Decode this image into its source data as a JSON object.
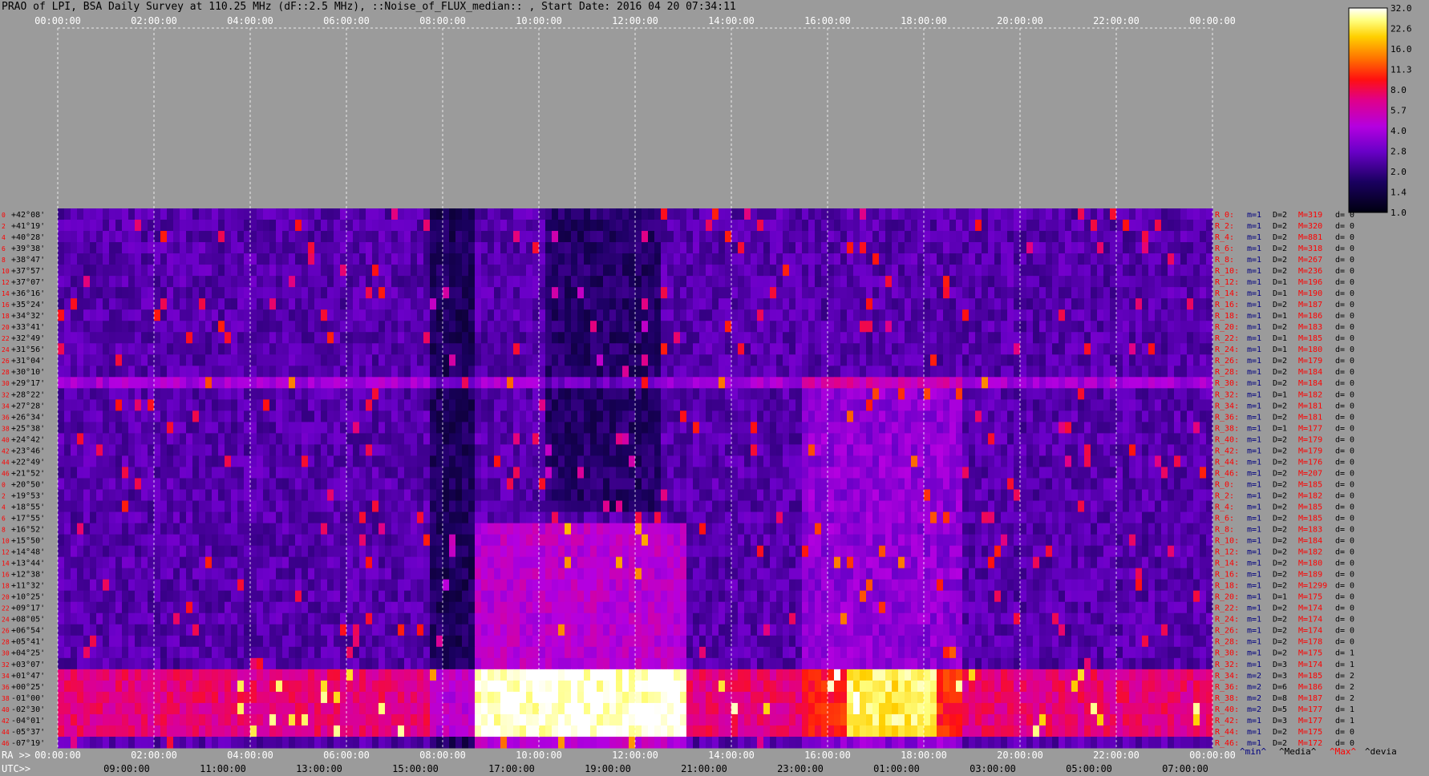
{
  "title": "PRAO of LPI, BSA Daily Survey at 110.25 MHz (dF::2.5 MHz), ::Noise_of_FLUX_median:: , Start Date: 2016 04 20 07:34:11",
  "chart_data": {
    "type": "heatmap",
    "title": "PRAO of LPI, BSA Daily Survey at 110.25 MHz (dF::2.5 MHz), ::Noise_of_FLUX_median:: , Start Date: 2016 04 20 07:34:11",
    "x_top_ticks": [
      "00:00:00",
      "02:00:00",
      "04:00:00",
      "06:00:00",
      "08:00:00",
      "10:00:00",
      "12:00:00",
      "14:00:00",
      "16:00:00",
      "18:00:00",
      "20:00:00",
      "22:00:00",
      "00:00:00"
    ],
    "ra_label": "RA >>",
    "ra_ticks": [
      "00:00:00",
      "02:00:00",
      "04:00:00",
      "06:00:00",
      "08:00:00",
      "10:00:00",
      "12:00:00",
      "14:00:00",
      "16:00:00",
      "18:00:00",
      "20:00:00",
      "22:00:00",
      "00:00:00"
    ],
    "utc_label": "UTC>>",
    "utc_ticks": [
      "09:00:00",
      "11:00:00",
      "13:00:00",
      "15:00:00",
      "17:00:00",
      "19:00:00",
      "21:00:00",
      "23:00:00",
      "01:00:00",
      "03:00:00",
      "05:00:00",
      "07:00:00"
    ],
    "declinations": [
      "+42°08'",
      "+41°19'",
      "+40°28'",
      "+39°38'",
      "+38°47'",
      "+37°57'",
      "+37°07'",
      "+36°16'",
      "+35°24'",
      "+34°32'",
      "+33°41'",
      "+32°49'",
      "+31°56'",
      "+31°04'",
      "+30°10'",
      "+29°17'",
      "+28°22'",
      "+27°28'",
      "+26°34'",
      "+25°38'",
      "+24°42'",
      "+23°46'",
      "+22°49'",
      "+21°52'",
      "+20°50'",
      "+19°53'",
      "+18°55'",
      "+17°55'",
      "+16°52'",
      "+15°50'",
      "+14°48'",
      "+13°44'",
      "+12°38'",
      "+11°32'",
      "+10°25'",
      "+09°17'",
      "+08°05'",
      "+06°54'",
      "+05°41'",
      "+04°25'",
      "+03°07'",
      "+01°47'",
      "+00°25'",
      "-01°00'",
      "-02°30'",
      "-04°01'",
      "-05°37'",
      "-07°19'"
    ],
    "row_index_labels": [
      "0",
      "2",
      "4",
      "6",
      "8",
      "10",
      "12",
      "14",
      "16",
      "18",
      "20",
      "22",
      "24",
      "26",
      "28",
      "30",
      "32",
      "34",
      "36",
      "38",
      "40",
      "42",
      "44",
      "46",
      "0",
      "2",
      "4",
      "6",
      "8",
      "10",
      "12",
      "14",
      "16",
      "18",
      "20",
      "22",
      "24",
      "26",
      "28",
      "30",
      "32",
      "34",
      "36",
      "38",
      "40",
      "42",
      "44",
      "46"
    ],
    "rows": [
      {
        "r": "R_0:",
        "min": "m=1",
        "dev": "D=2",
        "max": "M=319",
        "d": "d= 0"
      },
      {
        "r": "R_2:",
        "min": "m=1",
        "dev": "D=2",
        "max": "M=320",
        "d": "d= 0"
      },
      {
        "r": "R_4:",
        "min": "m=1",
        "dev": "D=2",
        "max": "M=881",
        "d": "d= 0"
      },
      {
        "r": "R_6:",
        "min": "m=1",
        "dev": "D=2",
        "max": "M=318",
        "d": "d= 0"
      },
      {
        "r": "R_8:",
        "min": "m=1",
        "dev": "D=2",
        "max": "M=267",
        "d": "d= 0"
      },
      {
        "r": "R_10:",
        "min": "m=1",
        "dev": "D=2",
        "max": "M=236",
        "d": "d= 0"
      },
      {
        "r": "R_12:",
        "min": "m=1",
        "dev": "D=1",
        "max": "M=196",
        "d": "d= 0"
      },
      {
        "r": "R_14:",
        "min": "m=1",
        "dev": "D=1",
        "max": "M=190",
        "d": "d= 0"
      },
      {
        "r": "R_16:",
        "min": "m=1",
        "dev": "D=2",
        "max": "M=187",
        "d": "d= 0"
      },
      {
        "r": "R_18:",
        "min": "m=1",
        "dev": "D=1",
        "max": "M=186",
        "d": "d= 0"
      },
      {
        "r": "R_20:",
        "min": "m=1",
        "dev": "D=2",
        "max": "M=183",
        "d": "d= 0"
      },
      {
        "r": "R_22:",
        "min": "m=1",
        "dev": "D=1",
        "max": "M=185",
        "d": "d= 0"
      },
      {
        "r": "R_24:",
        "min": "m=1",
        "dev": "D=1",
        "max": "M=180",
        "d": "d= 0"
      },
      {
        "r": "R_26:",
        "min": "m=1",
        "dev": "D=2",
        "max": "M=179",
        "d": "d= 0"
      },
      {
        "r": "R_28:",
        "min": "m=1",
        "dev": "D=2",
        "max": "M=184",
        "d": "d= 0"
      },
      {
        "r": "R_30:",
        "min": "m=1",
        "dev": "D=2",
        "max": "M=184",
        "d": "d= 0"
      },
      {
        "r": "R_32:",
        "min": "m=1",
        "dev": "D=1",
        "max": "M=182",
        "d": "d= 0"
      },
      {
        "r": "R_34:",
        "min": "m=1",
        "dev": "D=2",
        "max": "M=181",
        "d": "d= 0"
      },
      {
        "r": "R_36:",
        "min": "m=1",
        "dev": "D=2",
        "max": "M=181",
        "d": "d= 0"
      },
      {
        "r": "R_38:",
        "min": "m=1",
        "dev": "D=1",
        "max": "M=177",
        "d": "d= 0"
      },
      {
        "r": "R_40:",
        "min": "m=1",
        "dev": "D=2",
        "max": "M=179",
        "d": "d= 0"
      },
      {
        "r": "R_42:",
        "min": "m=1",
        "dev": "D=2",
        "max": "M=179",
        "d": "d= 0"
      },
      {
        "r": "R_44:",
        "min": "m=1",
        "dev": "D=2",
        "max": "M=176",
        "d": "d= 0"
      },
      {
        "r": "R_46:",
        "min": "m=1",
        "dev": "D=2",
        "max": "M=207",
        "d": "d= 0"
      },
      {
        "r": "R_0:",
        "min": "m=1",
        "dev": "D=2",
        "max": "M=185",
        "d": "d= 0"
      },
      {
        "r": "R_2:",
        "min": "m=1",
        "dev": "D=2",
        "max": "M=182",
        "d": "d= 0"
      },
      {
        "r": "R_4:",
        "min": "m=1",
        "dev": "D=2",
        "max": "M=185",
        "d": "d= 0"
      },
      {
        "r": "R_6:",
        "min": "m=1",
        "dev": "D=2",
        "max": "M=185",
        "d": "d= 0"
      },
      {
        "r": "R_8:",
        "min": "m=1",
        "dev": "D=2",
        "max": "M=183",
        "d": "d= 0"
      },
      {
        "r": "R_10:",
        "min": "m=1",
        "dev": "D=2",
        "max": "M=184",
        "d": "d= 0"
      },
      {
        "r": "R_12:",
        "min": "m=1",
        "dev": "D=2",
        "max": "M=182",
        "d": "d= 0"
      },
      {
        "r": "R_14:",
        "min": "m=1",
        "dev": "D=2",
        "max": "M=180",
        "d": "d= 0"
      },
      {
        "r": "R_16:",
        "min": "m=1",
        "dev": "D=2",
        "max": "M=189",
        "d": "d= 0"
      },
      {
        "r": "R_18:",
        "min": "m=1",
        "dev": "D=2",
        "max": "M=1299",
        "d": "d= 0"
      },
      {
        "r": "R_20:",
        "min": "m=1",
        "dev": "D=1",
        "max": "M=175",
        "d": "d= 0"
      },
      {
        "r": "R_22:",
        "min": "m=1",
        "dev": "D=2",
        "max": "M=174",
        "d": "d= 0"
      },
      {
        "r": "R_24:",
        "min": "m=1",
        "dev": "D=2",
        "max": "M=174",
        "d": "d= 0"
      },
      {
        "r": "R_26:",
        "min": "m=1",
        "dev": "D=2",
        "max": "M=174",
        "d": "d= 0"
      },
      {
        "r": "R_28:",
        "min": "m=1",
        "dev": "D=2",
        "max": "M=178",
        "d": "d= 0"
      },
      {
        "r": "R_30:",
        "min": "m=1",
        "dev": "D=2",
        "max": "M=175",
        "d": "d= 1"
      },
      {
        "r": "R_32:",
        "min": "m=1",
        "dev": "D=3",
        "max": "M=174",
        "d": "d= 1"
      },
      {
        "r": "R_34:",
        "min": "m=2",
        "dev": "D=3",
        "max": "M=185",
        "d": "d= 2"
      },
      {
        "r": "R_36:",
        "min": "m=2",
        "dev": "D=6",
        "max": "M=186",
        "d": "d= 2"
      },
      {
        "r": "R_38:",
        "min": "m=2",
        "dev": "D=8",
        "max": "M=187",
        "d": "d= 2"
      },
      {
        "r": "R_40:",
        "min": "m=2",
        "dev": "D=5",
        "max": "M=177",
        "d": "d= 1"
      },
      {
        "r": "R_42:",
        "min": "m=1",
        "dev": "D=3",
        "max": "M=177",
        "d": "d= 1"
      },
      {
        "r": "R_44:",
        "min": "m=1",
        "dev": "D=2",
        "max": "M=175",
        "d": "d= 0"
      },
      {
        "r": "R_46:",
        "min": "m=1",
        "dev": "D=2",
        "max": "M=172",
        "d": "d= 0"
      }
    ],
    "legend_footer": {
      "min": "^min^",
      "media": "^Media^",
      "max": "^Max^",
      "devia": "^devia"
    },
    "colorbar": {
      "ticks": [
        "32.0",
        "22.6",
        "16.0",
        "11.3",
        "8.0",
        "5.7",
        "4.0",
        "2.8",
        "2.0",
        "1.4",
        "1.0"
      ],
      "range": [
        1.0,
        32.0
      ],
      "scale": "log"
    },
    "colors": {
      "background": "#9b9b9b",
      "row_label": "#ff0000",
      "min_label": "#000080",
      "max_label": "#ff0000"
    }
  }
}
